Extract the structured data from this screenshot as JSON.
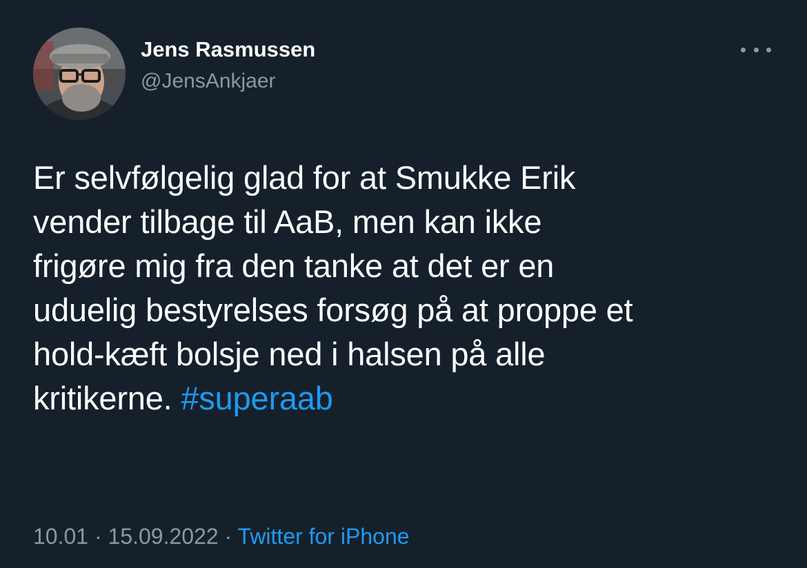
{
  "tweet": {
    "author": {
      "display_name": "Jens Rasmussen",
      "handle": "@JensAnkjaer"
    },
    "more_icon": "more-horizontal-icon",
    "text_lines": [
      "Er selvfølgelig glad for at Smukke Erik",
      "vender tilbage til AaB, men kan ikke",
      "frigøre mig fra den tanke at det er en",
      "uduelig bestyrelses forsøg på at proppe et",
      "hold-kæft bolsje ned i halsen på alle"
    ],
    "last_line_text": "kritikerne. ",
    "hashtag": "#superaab",
    "time": "10.01",
    "separator": " · ",
    "date": "15.09.2022",
    "source": "Twitter for iPhone"
  },
  "colors": {
    "background": "#15202b",
    "primary_text": "#ffffff",
    "secondary_text": "#8b98a5",
    "link": "#1d9bf0"
  }
}
